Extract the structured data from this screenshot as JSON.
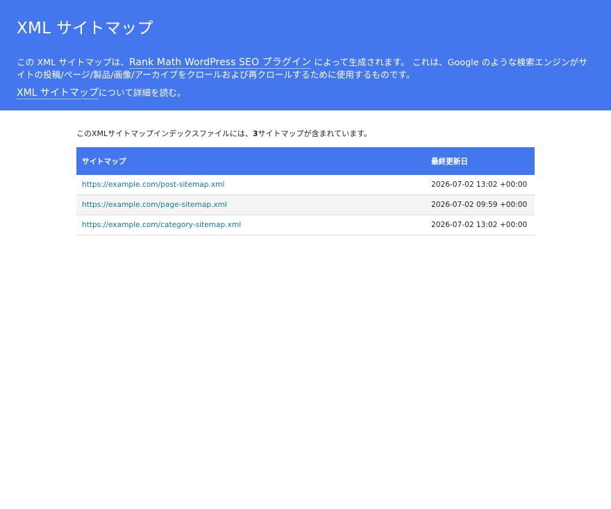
{
  "header": {
    "title": "XML サイトマップ",
    "intro_prefix": "この XML サイトマップは、",
    "intro_link": "Rank Math WordPress SEO プラグイン",
    "intro_suffix": " によって生成されます。 これは、Google のような検索エンジンがサイトの投稿/ページ/製品/画像/アーカイブをクロールおよび再クロールするために使用するものです。",
    "more_link": "XML サイトマップ",
    "more_suffix": "について詳細を読む。"
  },
  "summary": {
    "prefix": "このXMLサイトマップインデックスファイルには、",
    "count": "3",
    "suffix": "サイトマップが含まれています。"
  },
  "table": {
    "headers": [
      "サイトマップ",
      "最終更新日"
    ],
    "rows": [
      {
        "url": "https://example.com/post-sitemap.xml",
        "date": "2026-07-02 13:02 +00:00"
      },
      {
        "url": "https://example.com/page-sitemap.xml",
        "date": "2026-07-02 09:59 +00:00"
      },
      {
        "url": "https://example.com/category-sitemap.xml",
        "date": "2026-07-02 13:02 +00:00"
      }
    ]
  },
  "colors": {
    "header_bg": "#4477ee",
    "link": "#0e7b95"
  }
}
